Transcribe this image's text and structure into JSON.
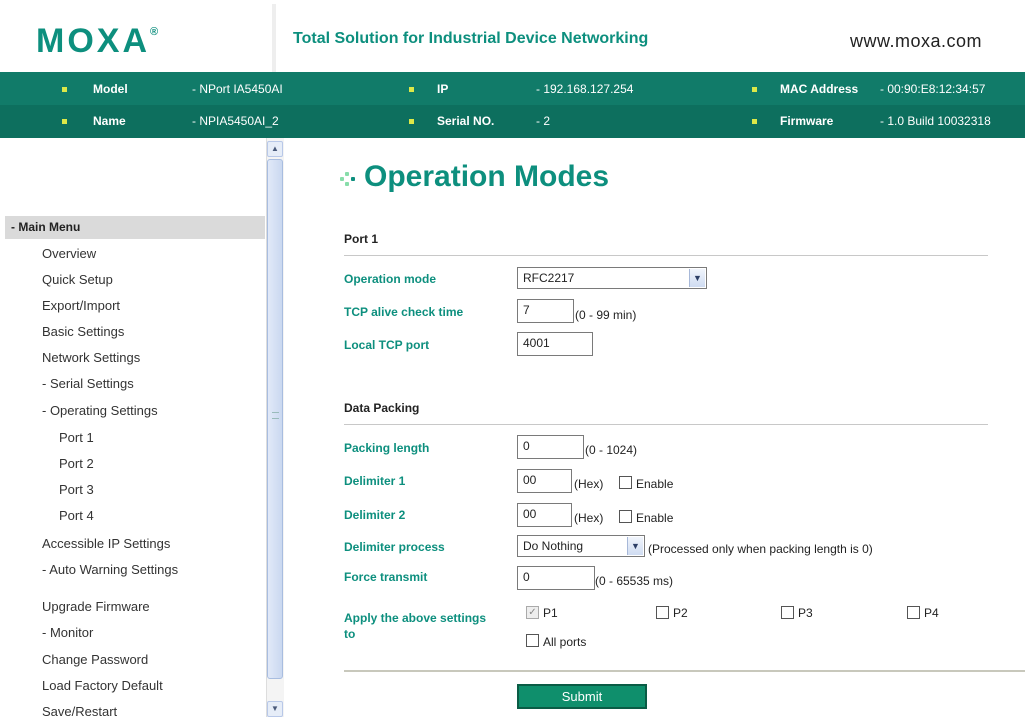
{
  "header": {
    "logo": "MOXA",
    "logo_mark": "®",
    "tagline": "Total Solution for Industrial Device Networking",
    "website": "www.moxa.com"
  },
  "device_info": {
    "model_label": "Model",
    "model_value": "- NPort IA5450AI",
    "name_label": "Name",
    "name_value": "- NPIA5450AI_2",
    "ip_label": "IP",
    "ip_value": "- 192.168.127.254",
    "serial_label": "Serial NO.",
    "serial_value": "- 2",
    "mac_label": "MAC Address",
    "mac_value": "- 00:90:E8:12:34:57",
    "firmware_label": "Firmware",
    "firmware_value": "- 1.0 Build 10032318"
  },
  "sidebar": {
    "menu_title": "- Main Menu",
    "items": [
      {
        "label": "Overview"
      },
      {
        "label": "Quick Setup"
      },
      {
        "label": "Export/Import"
      },
      {
        "label": "Basic Settings"
      },
      {
        "label": "Network Settings"
      },
      {
        "label": "- Serial Settings"
      },
      {
        "label": "- Operating Settings"
      },
      {
        "label": "Port 1"
      },
      {
        "label": "Port 2"
      },
      {
        "label": "Port 3"
      },
      {
        "label": "Port 4"
      },
      {
        "label": "Accessible IP Settings"
      },
      {
        "label": "- Auto Warning Settings"
      },
      {
        "label": "Upgrade Firmware"
      },
      {
        "label": "- Monitor"
      },
      {
        "label": "Change Password"
      },
      {
        "label": "Load Factory Default"
      },
      {
        "label": "Save/Restart"
      }
    ]
  },
  "main": {
    "title": "Operation Modes",
    "port_section": "Port 1",
    "operation_mode_label": "Operation mode",
    "operation_mode_value": "RFC2217",
    "tcp_alive_label": "TCP alive check time",
    "tcp_alive_value": "7",
    "tcp_alive_hint": "(0 - 99 min)",
    "local_tcp_label": "Local TCP port",
    "local_tcp_value": "4001",
    "packing_section": "Data Packing",
    "packing_length_label": "Packing length",
    "packing_length_value": "0",
    "packing_length_hint": "(0 - 1024)",
    "delimiter1_label": "Delimiter 1",
    "delimiter1_value": "00",
    "delimiter1_hint": "(Hex)",
    "delimiter1_enable": "Enable",
    "delimiter2_label": "Delimiter 2",
    "delimiter2_value": "00",
    "delimiter2_hint": "(Hex)",
    "delimiter2_enable": "Enable",
    "delimiter_process_label": "Delimiter process",
    "delimiter_process_value": "Do Nothing",
    "delimiter_process_hint": "(Processed only when packing length is 0)",
    "force_transmit_label": "Force transmit",
    "force_transmit_value": "0",
    "force_transmit_hint": "(0 - 65535 ms)",
    "apply_label_line1": "Apply the above settings",
    "apply_label_line2": "to",
    "ports": [
      {
        "label": "P1",
        "checked": true,
        "disabled": true
      },
      {
        "label": "P2",
        "checked": false
      },
      {
        "label": "P3",
        "checked": false
      },
      {
        "label": "P4",
        "checked": false
      }
    ],
    "all_ports_label": "All ports",
    "submit_label": "Submit"
  },
  "colors": {
    "brand": "#0d8f7e",
    "infobar": "#117b69",
    "bullet": "#dce848"
  }
}
